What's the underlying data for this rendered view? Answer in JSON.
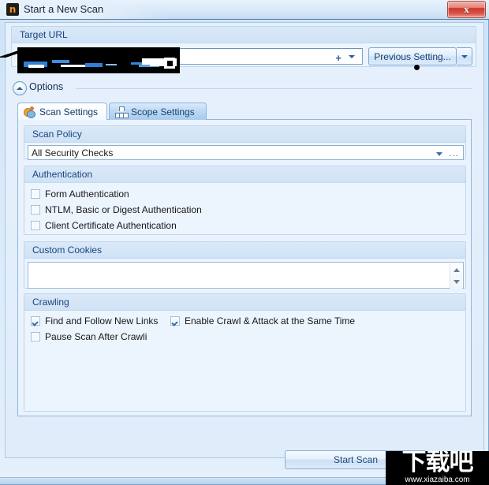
{
  "window": {
    "title": "Start a New Scan",
    "app_icon": "netsparker-n-icon",
    "close_label": "x"
  },
  "target_url": {
    "group_label": "Target URL",
    "input_value": "",
    "input_placeholder": "",
    "add_icon": "+",
    "dropdown_icon": "chevron-down-icon",
    "previous_setting_label": "Previous Setting...",
    "previous_setting_dropdown_icon": "chevron-down-icon"
  },
  "options": {
    "label": "Options",
    "collapse_icon": "chevron-up-icon"
  },
  "tabs": [
    {
      "label": "Scan Settings",
      "icon": "scan-settings-icon",
      "active": true
    },
    {
      "label": "Scope Settings",
      "icon": "scope-settings-icon",
      "active": false
    }
  ],
  "scan_policy": {
    "group_label": "Scan Policy",
    "value": "All Security Checks",
    "dropdown_icon": "chevron-down-icon",
    "browse_label": "..."
  },
  "authentication": {
    "group_label": "Authentication",
    "items": [
      {
        "label": "Form Authentication",
        "checked": false
      },
      {
        "label": "NTLM, Basic or Digest Authentication",
        "checked": false
      },
      {
        "label": "Client Certificate Authentication",
        "checked": false
      }
    ]
  },
  "custom_cookies": {
    "group_label": "Custom Cookies",
    "value": "",
    "scroll_up_icon": "triangle-up-icon",
    "scroll_down_icon": "triangle-down-icon"
  },
  "crawling": {
    "group_label": "Crawling",
    "items": [
      {
        "label": "Find and Follow New Links",
        "checked": true
      },
      {
        "label": "Enable Crawl & Attack at the Same Time",
        "checked": true
      },
      {
        "label": "Pause Scan After Crawli",
        "checked": false
      }
    ]
  },
  "footer": {
    "start_scan_label": "Start Scan"
  },
  "watermark": {
    "logo_text": "下载吧",
    "url": "www.xiazaiba.com"
  },
  "colors": {
    "accent": "#17447e",
    "title_text": "#13263c",
    "close_red": "#c9392e",
    "panel_bg": "#eaf3fd",
    "group_header": "#dbe9f8"
  }
}
